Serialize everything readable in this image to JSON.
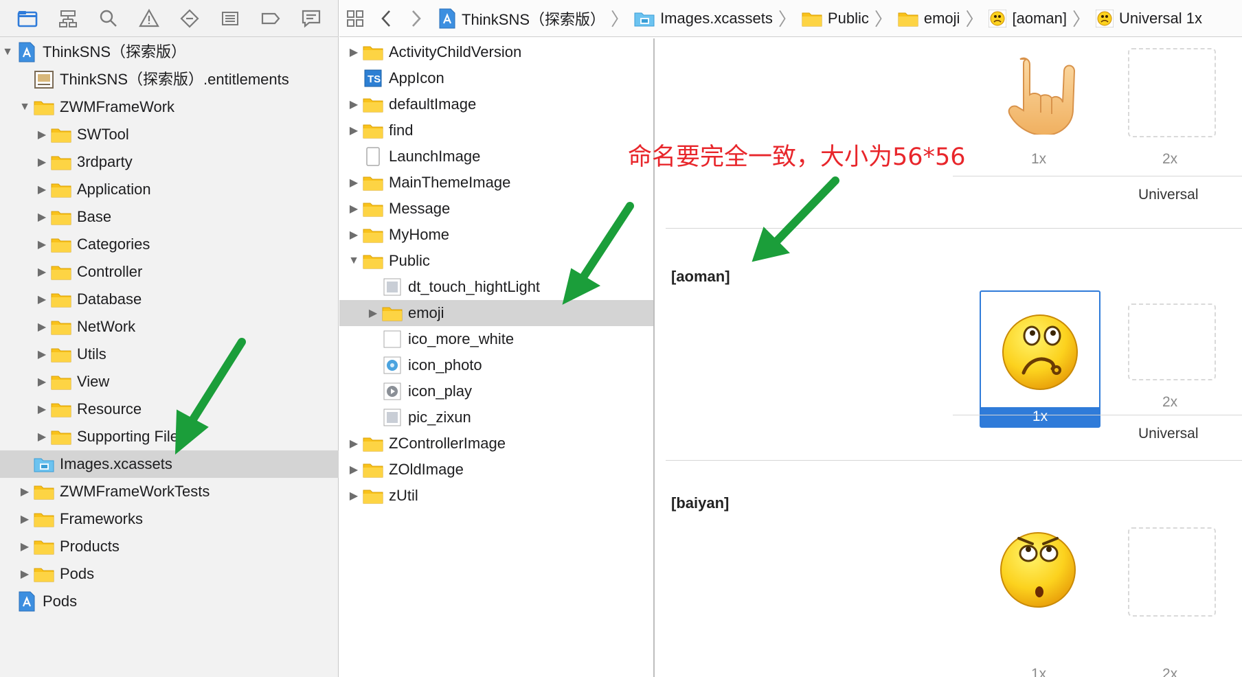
{
  "colors": {
    "accent": "#2f7bd9",
    "folder": "#f9c21b",
    "annotation": "#e8262b",
    "arrow": "#1b9e3a"
  },
  "navigator": {
    "toolbar_icons": [
      "folder-icon",
      "hierarchy-icon",
      "search-icon",
      "warning-icon",
      "test-icon",
      "debug-icon",
      "breakpoint-icon",
      "report-icon"
    ],
    "items": [
      {
        "label": "ThinkSNS（探索版）",
        "icon": "project-icon",
        "indent": 0,
        "disclosure": "open"
      },
      {
        "label": "ThinkSNS（探索版）.entitlements",
        "icon": "entitlements-icon",
        "indent": 1,
        "disclosure": "none"
      },
      {
        "label": "ZWMFrameWork",
        "icon": "folder-icon",
        "indent": 1,
        "disclosure": "open"
      },
      {
        "label": "SWTool",
        "icon": "folder-icon",
        "indent": 2,
        "disclosure": "closed"
      },
      {
        "label": "3rdparty",
        "icon": "folder-icon",
        "indent": 2,
        "disclosure": "closed"
      },
      {
        "label": "Application",
        "icon": "folder-icon",
        "indent": 2,
        "disclosure": "closed"
      },
      {
        "label": "Base",
        "icon": "folder-icon",
        "indent": 2,
        "disclosure": "closed"
      },
      {
        "label": "Categories",
        "icon": "folder-icon",
        "indent": 2,
        "disclosure": "closed"
      },
      {
        "label": "Controller",
        "icon": "folder-icon",
        "indent": 2,
        "disclosure": "closed"
      },
      {
        "label": "Database",
        "icon": "folder-icon",
        "indent": 2,
        "disclosure": "closed"
      },
      {
        "label": "NetWork",
        "icon": "folder-icon",
        "indent": 2,
        "disclosure": "closed"
      },
      {
        "label": "Utils",
        "icon": "folder-icon",
        "indent": 2,
        "disclosure": "closed"
      },
      {
        "label": "View",
        "icon": "folder-icon",
        "indent": 2,
        "disclosure": "closed"
      },
      {
        "label": "Resource",
        "icon": "folder-icon",
        "indent": 2,
        "disclosure": "closed"
      },
      {
        "label": "Supporting Files",
        "icon": "folder-icon",
        "indent": 2,
        "disclosure": "closed"
      },
      {
        "label": "Images.xcassets",
        "icon": "xcassets-icon",
        "indent": 1,
        "disclosure": "none",
        "selected": true
      },
      {
        "label": "ZWMFrameWorkTests",
        "icon": "folder-icon",
        "indent": 1,
        "disclosure": "closed"
      },
      {
        "label": "Frameworks",
        "icon": "folder-icon",
        "indent": 1,
        "disclosure": "closed"
      },
      {
        "label": "Products",
        "icon": "folder-icon",
        "indent": 1,
        "disclosure": "closed"
      },
      {
        "label": "Pods",
        "icon": "folder-icon",
        "indent": 1,
        "disclosure": "closed"
      },
      {
        "label": "Pods",
        "icon": "project-icon",
        "indent": 0,
        "disclosure": "none"
      }
    ]
  },
  "jumpbar": {
    "crumbs": [
      {
        "label": "ThinkSNS（探索版）",
        "icon": "project-icon"
      },
      {
        "label": "Images.xcassets",
        "icon": "xcassets-icon"
      },
      {
        "label": "Public",
        "icon": "folder-icon"
      },
      {
        "label": "emoji",
        "icon": "folder-icon"
      },
      {
        "label": "[aoman]",
        "icon": "emoji-icon"
      },
      {
        "label": "Universal 1x",
        "icon": "emoji-icon"
      }
    ]
  },
  "assets": {
    "items": [
      {
        "label": "ActivityChildVersion",
        "icon": "folder-icon",
        "indent": 0,
        "disclosure": "closed"
      },
      {
        "label": "AppIcon",
        "icon": "appicon-icon",
        "indent": 0,
        "disclosure": "none"
      },
      {
        "label": "defaultImage",
        "icon": "folder-icon",
        "indent": 0,
        "disclosure": "closed"
      },
      {
        "label": "find",
        "icon": "folder-icon",
        "indent": 0,
        "disclosure": "closed"
      },
      {
        "label": "LaunchImage",
        "icon": "launch-image-icon",
        "indent": 0,
        "disclosure": "none"
      },
      {
        "label": "MainThemeImage",
        "icon": "folder-icon",
        "indent": 0,
        "disclosure": "closed"
      },
      {
        "label": "Message",
        "icon": "folder-icon",
        "indent": 0,
        "disclosure": "closed"
      },
      {
        "label": "MyHome",
        "icon": "folder-icon",
        "indent": 0,
        "disclosure": "closed"
      },
      {
        "label": "Public",
        "icon": "folder-icon",
        "indent": 0,
        "disclosure": "open"
      },
      {
        "label": "dt_touch_hightLight",
        "icon": "image-set-icon",
        "indent": 1,
        "disclosure": "none"
      },
      {
        "label": "emoji",
        "icon": "folder-icon",
        "indent": 1,
        "disclosure": "closed",
        "selected": true
      },
      {
        "label": "ico_more_white",
        "icon": "blank-image-icon",
        "indent": 1,
        "disclosure": "none"
      },
      {
        "label": "icon_photo",
        "icon": "photo-image-icon",
        "indent": 1,
        "disclosure": "none"
      },
      {
        "label": "icon_play",
        "icon": "play-image-icon",
        "indent": 1,
        "disclosure": "none"
      },
      {
        "label": "pic_zixun",
        "icon": "image-set-icon",
        "indent": 1,
        "disclosure": "none"
      },
      {
        "label": "ZControllerImage",
        "icon": "folder-icon",
        "indent": 0,
        "disclosure": "closed"
      },
      {
        "label": "ZOldImage",
        "icon": "folder-icon",
        "indent": 0,
        "disclosure": "closed"
      },
      {
        "label": "zUtil",
        "icon": "folder-icon",
        "indent": 0,
        "disclosure": "closed"
      }
    ]
  },
  "detail": {
    "slot_1x": "1x",
    "slot_2x": "2x",
    "universal": "Universal",
    "sets": [
      {
        "name": "",
        "emoji": "rock-hand-emoji",
        "selected_1x": false
      },
      {
        "name": "[aoman]",
        "emoji": "confused-face-emoji",
        "selected_1x": true
      },
      {
        "name": "[baiyan]",
        "emoji": "eye-roll-face-emoji",
        "selected_1x": false
      }
    ]
  },
  "annotation": {
    "text": "命名要完全一致，大小为56*56"
  }
}
